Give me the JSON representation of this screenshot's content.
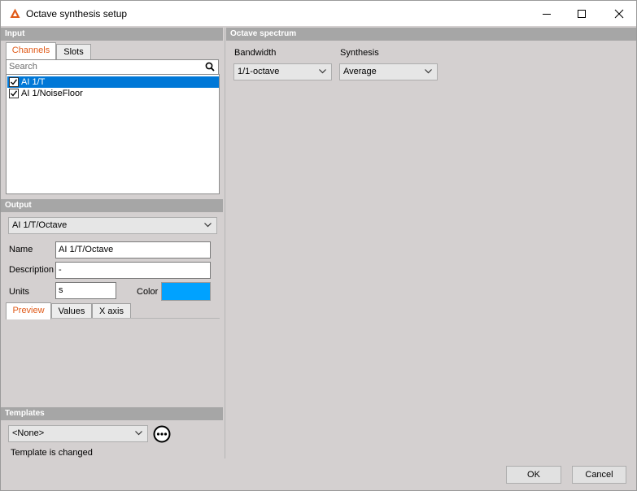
{
  "window": {
    "title": "Octave synthesis setup",
    "app_icon": "dewesoft-triangle-icon",
    "accent_color": "#e05a18"
  },
  "input": {
    "header": "Input",
    "tabs": [
      {
        "label": "Channels",
        "active": true
      },
      {
        "label": "Slots",
        "active": false
      }
    ],
    "search": {
      "placeholder": "Search",
      "value": ""
    },
    "channels": [
      {
        "label": "AI 1/T",
        "checked": true,
        "selected": true
      },
      {
        "label": "AI 1/NoiseFloor",
        "checked": true,
        "selected": false
      }
    ]
  },
  "output": {
    "header": "Output",
    "selected_channel": "AI 1/T/Octave",
    "name_label": "Name",
    "name_value": "AI 1/T/Octave",
    "description_label": "Description",
    "description_value": "-",
    "units_label": "Units",
    "units_value": "s",
    "color_label": "Color",
    "color_value": "#00a2ff",
    "tabs": [
      {
        "label": "Preview",
        "active": true
      },
      {
        "label": "Values",
        "active": false
      },
      {
        "label": "X axis",
        "active": false
      }
    ]
  },
  "templates": {
    "header": "Templates",
    "selected": "<None>",
    "status": "Template is changed"
  },
  "octave_spectrum": {
    "header": "Octave spectrum",
    "bandwidth_label": "Bandwidth",
    "bandwidth_value": "1/1-octave",
    "synthesis_label": "Synthesis",
    "synthesis_value": "Average"
  },
  "footer": {
    "ok_label": "OK",
    "cancel_label": "Cancel"
  }
}
